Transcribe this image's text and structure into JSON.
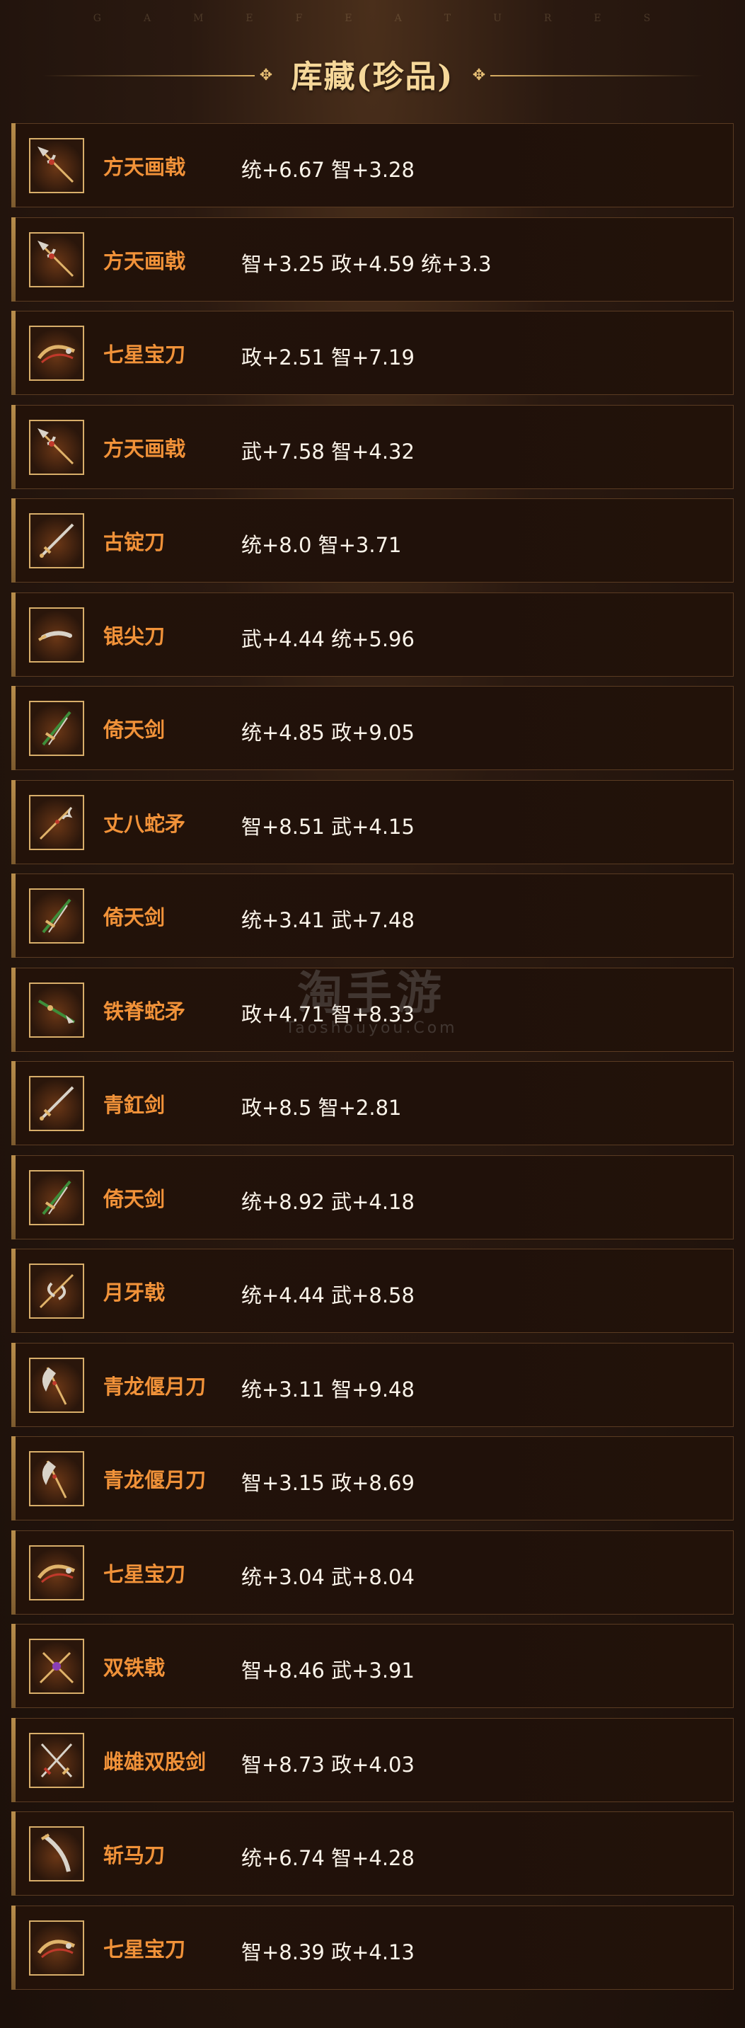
{
  "header": {
    "top_letters": [
      "G",
      "A",
      "M",
      "E",
      "F",
      "E",
      "A",
      "T",
      "U",
      "R",
      "E",
      "S"
    ],
    "title": "库藏(珍品)"
  },
  "watermark": {
    "title": "淘手游",
    "subtitle": "Taoshouyou.Com"
  },
  "items": [
    {
      "name": "方天画戟",
      "stats": "统+6.67 智+3.28",
      "icon": "halberd-icon"
    },
    {
      "name": "方天画戟",
      "stats": "智+3.25 政+4.59 统+3.3",
      "icon": "halberd-icon"
    },
    {
      "name": "七星宝刀",
      "stats": "政+2.51 智+7.19",
      "icon": "dragon-blade-icon"
    },
    {
      "name": "方天画戟",
      "stats": "武+7.58 智+4.32",
      "icon": "halberd-icon"
    },
    {
      "name": "古锭刀",
      "stats": "统+8.0 智+3.71",
      "icon": "sword-icon"
    },
    {
      "name": "银尖刀",
      "stats": "武+4.44 统+5.96",
      "icon": "knife-icon"
    },
    {
      "name": "倚天剑",
      "stats": "统+4.85 政+9.05",
      "icon": "green-sword-icon"
    },
    {
      "name": "丈八蛇矛",
      "stats": "智+8.51 武+4.15",
      "icon": "serpent-spear-icon"
    },
    {
      "name": "倚天剑",
      "stats": "统+3.41 武+7.48",
      "icon": "green-sword-icon"
    },
    {
      "name": "铁脊蛇矛",
      "stats": "政+4.71 智+8.33",
      "icon": "green-spear-icon"
    },
    {
      "name": "青釭剑",
      "stats": "政+8.5 智+2.81",
      "icon": "sword-icon"
    },
    {
      "name": "倚天剑",
      "stats": "统+8.92 武+4.18",
      "icon": "green-sword-icon"
    },
    {
      "name": "月牙戟",
      "stats": "统+4.44 武+8.58",
      "icon": "crescent-halberd-icon"
    },
    {
      "name": "青龙偃月刀",
      "stats": "统+3.11 智+9.48",
      "icon": "glaive-icon"
    },
    {
      "name": "青龙偃月刀",
      "stats": "智+3.15 政+8.69",
      "icon": "glaive-icon"
    },
    {
      "name": "七星宝刀",
      "stats": "统+3.04 武+8.04",
      "icon": "dragon-blade-icon"
    },
    {
      "name": "双铁戟",
      "stats": "智+8.46 武+3.91",
      "icon": "twin-halberd-icon"
    },
    {
      "name": "雌雄双股剑",
      "stats": "智+8.73 政+4.03",
      "icon": "twin-swords-icon"
    },
    {
      "name": "斩马刀",
      "stats": "统+6.74 智+4.28",
      "icon": "saber-icon"
    },
    {
      "name": "七星宝刀",
      "stats": "智+8.39 政+4.13",
      "icon": "dragon-blade-icon"
    }
  ]
}
